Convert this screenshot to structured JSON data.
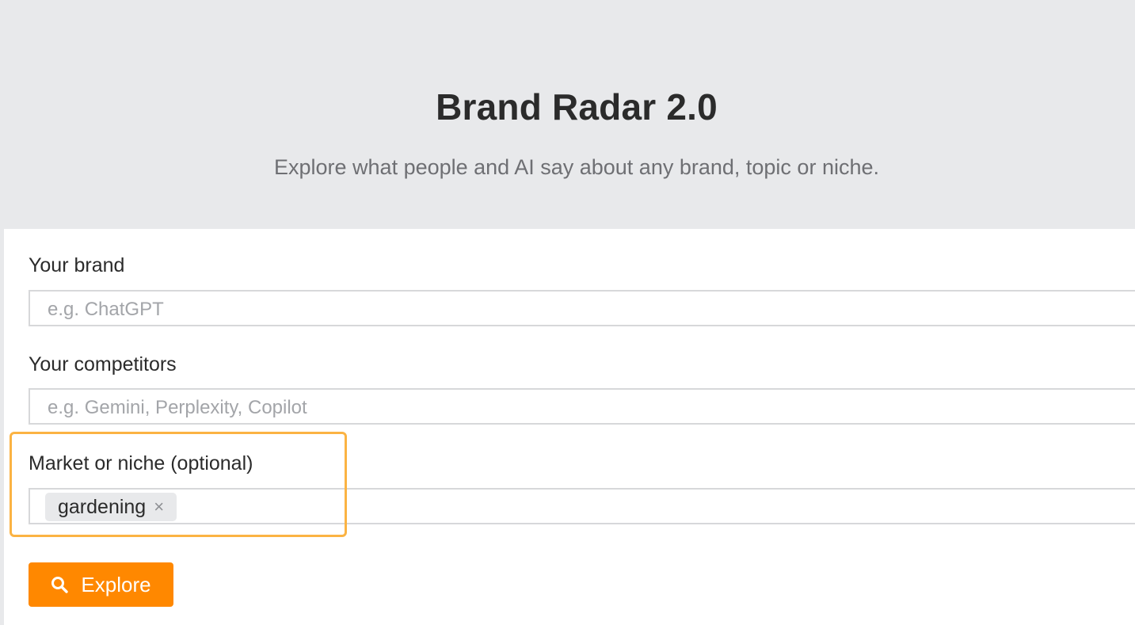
{
  "header": {
    "title": "Brand Radar 2.0",
    "subtitle": "Explore what people and AI say about any brand, topic or niche."
  },
  "form": {
    "brand": {
      "label": "Your brand",
      "placeholder": "e.g. ChatGPT"
    },
    "competitors": {
      "label": "Your competitors",
      "placeholder": "e.g. Gemini, Perplexity, Copilot"
    },
    "market": {
      "label": "Market or niche (optional)",
      "tags": [
        {
          "label": "gardening",
          "remove_icon": "×"
        }
      ]
    },
    "explore_button": {
      "label": "Explore",
      "icon": "search-icon"
    }
  },
  "colors": {
    "accent": "#ff8800",
    "highlight": "#fbb343",
    "hero_bg": "#e8e9eb"
  }
}
